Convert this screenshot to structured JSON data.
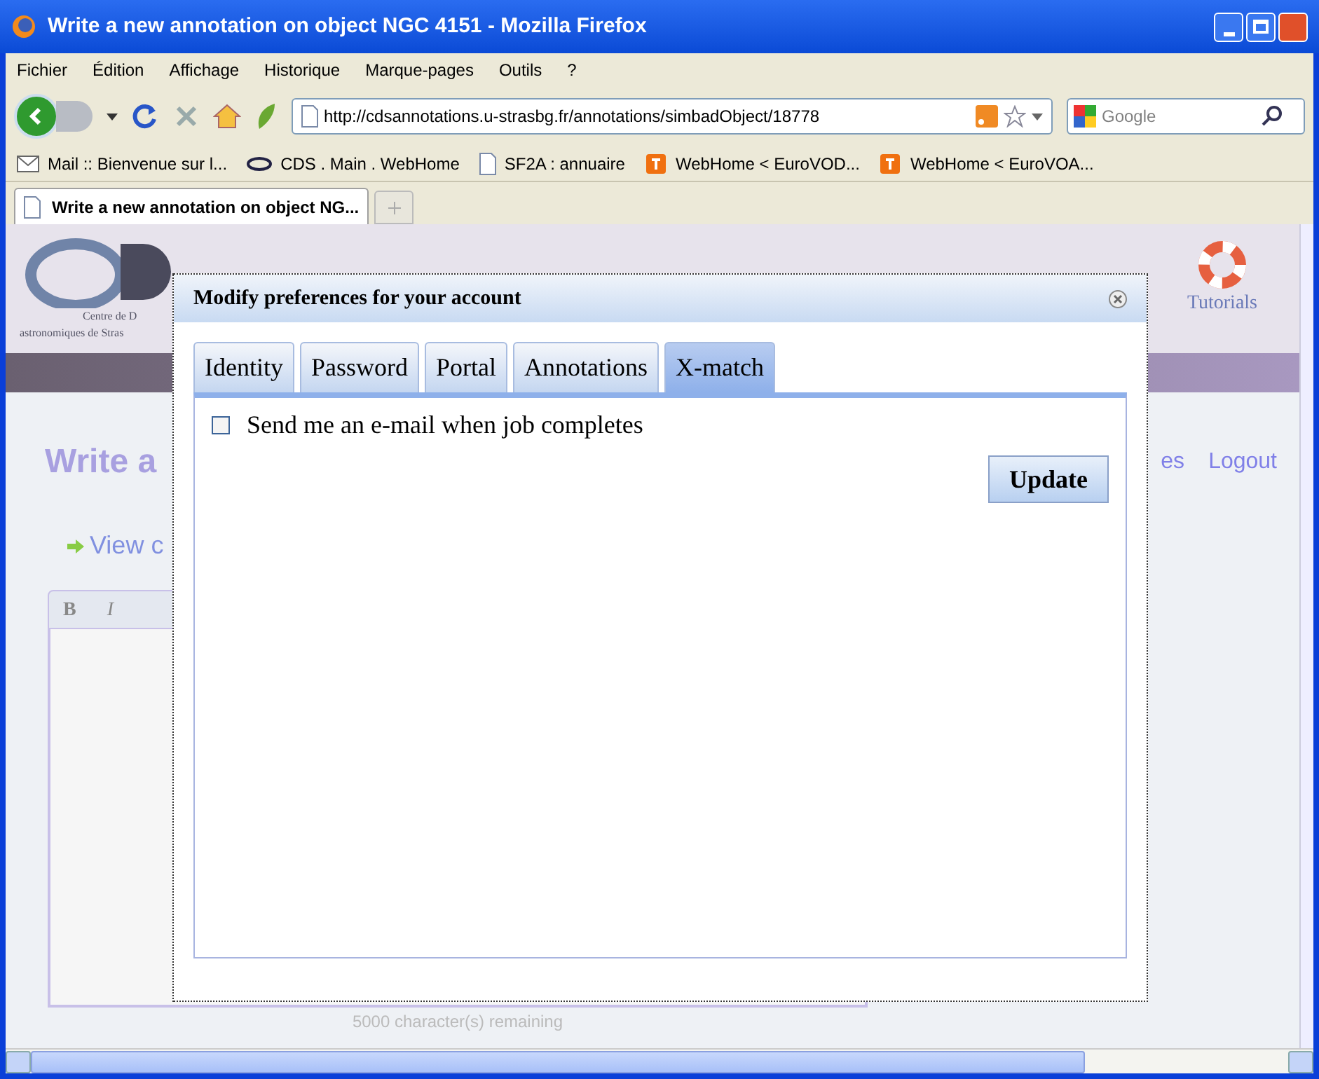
{
  "window": {
    "title": "Write a new annotation on object NGC 4151 - Mozilla Firefox"
  },
  "menu": [
    "Fichier",
    "Édition",
    "Affichage",
    "Historique",
    "Marque-pages",
    "Outils",
    "?"
  ],
  "address": {
    "value": "http://cdsannotations.u-strasbg.fr/annotations/simbadObject/18778"
  },
  "search": {
    "placeholder": "Google"
  },
  "bookmarks": [
    {
      "label": "Mail :: Bienvenue sur l..."
    },
    {
      "label": "CDS . Main . WebHome"
    },
    {
      "label": "SF2A : annuaire"
    },
    {
      "label": "WebHome < EuroVOD..."
    },
    {
      "label": "WebHome < EuroVOA..."
    }
  ],
  "browser_tabs": [
    {
      "label": "Write a new annotation on object NG...",
      "selected": true
    }
  ],
  "page": {
    "logo_text": [
      "Centre de D",
      "astronomiques de Stras"
    ],
    "header_link": "Tutorials",
    "heading": "Write a",
    "links": [
      "es",
      "Logout"
    ],
    "view_link": "View c",
    "editor_buttons": [
      "B",
      "I"
    ],
    "remaining": "5000 character(s) remaining"
  },
  "dialog": {
    "title": "Modify preferences for your account",
    "tabs": [
      {
        "label": "Identity",
        "selected": false
      },
      {
        "label": "Password",
        "selected": false
      },
      {
        "label": "Portal",
        "selected": false
      },
      {
        "label": "Annotations",
        "selected": false
      },
      {
        "label": "X-match",
        "selected": true
      }
    ],
    "checkbox": {
      "label": "Send me an e-mail when job completes",
      "checked": false
    },
    "button": "Update"
  }
}
